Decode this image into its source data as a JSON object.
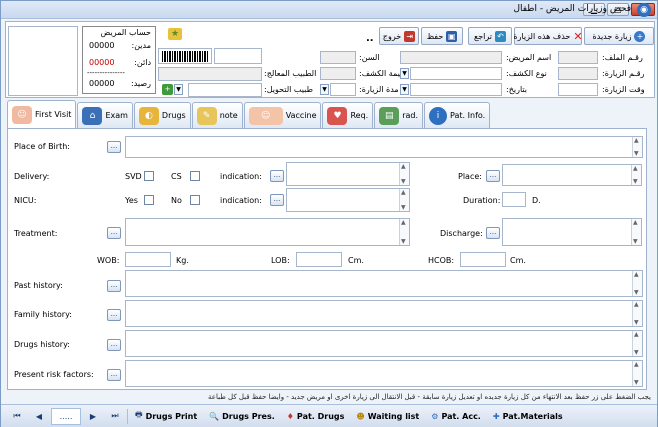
{
  "window": {
    "title": "فحص وزيارات المريض - اطفال"
  },
  "toolbar": {
    "new_visit": "زيارة جديدة",
    "delete_visit": "حذف هذه الزيارة",
    "undo": "تراجع",
    "save": "حفظ",
    "exit": "خروج",
    "dots": ".."
  },
  "header": {
    "file_no_label": "رقـم الملف:",
    "visit_no_label": "رقـم الزيارة:",
    "visit_time_label": "وقت الزيارة:",
    "patient_name_label": "اسم المريض:",
    "exam_type_label": "نوع الكشف:",
    "date_label": "بتاريخ:",
    "age_label": "السن:",
    "exam_value_label": "قيمة الكشف:",
    "visit_duration_label": "مدة الزيارة:",
    "treating_doctor_label": "الطبيب المعالج:",
    "referring_doctor_label": "طبيب التحويل:"
  },
  "account": {
    "title": "حساب المريض",
    "debit_label": "مدين:",
    "debit_value": "00000",
    "credit_label": "دائن:",
    "credit_value": "00000",
    "divider": "---------------",
    "balance_label": "رصيد:",
    "balance_value": "00000"
  },
  "tabs": [
    {
      "label": "First Visit",
      "icon": "baby-icon",
      "color": "#f2b9a1"
    },
    {
      "label": "Exam",
      "icon": "exam-icon",
      "color": "#3b6fb6"
    },
    {
      "label": "Drugs",
      "icon": "pills-icon",
      "color": "#e7b53a"
    },
    {
      "label": "note",
      "icon": "note-icon",
      "color": "#e8c55a"
    },
    {
      "label": "Vaccine",
      "icon": "vaccine-baby-icon",
      "color": "#f3c4a8"
    },
    {
      "label": "Req.",
      "icon": "request-icon",
      "color": "#d9534f"
    },
    {
      "label": "rad.",
      "icon": "radiology-icon",
      "color": "#5a9e5a"
    },
    {
      "label": "Pat. Info.",
      "icon": "info-icon",
      "color": "#2e6fbf"
    }
  ],
  "form": {
    "place_of_birth": "Place of Birth:",
    "delivery": "Delivery:",
    "svd": "SVD",
    "cs": "CS",
    "indication": "indication:",
    "place": "Place:",
    "nicu": "NICU:",
    "yes": "Yes",
    "no": "No",
    "indication2": "indication:",
    "duration": "Duration:",
    "duration_unit": "D.",
    "treatment": "Treatment:",
    "discharge": "Discharge:",
    "wob": "WOB:",
    "kg": "Kg.",
    "lob": "LOB:",
    "cm1": "Cm.",
    "hcob": "HCOB:",
    "cm2": "Cm.",
    "past_history": "Past history:",
    "family_history": "Family history:",
    "drugs_history": "Drugs history:",
    "present_risk": "Present risk factors:"
  },
  "footnote": "يجب الضغط على زر حفظ بعد الانتهاء من كل زيارة جديده او تعديل زيارة سابقة - قبل الانتقال الى زيارة اخرى او مريض جديد - وايضا حفظ قبل كل طباعة",
  "bottombar": {
    "pager": ".....",
    "drugs_print": "Drugs Print",
    "drugs_pres": "Drugs Pres.",
    "pat_drugs": "Pat. Drugs",
    "waiting_list": "Waiting list",
    "pat_acc": "Pat. Acc.",
    "pat_materials": "Pat.Materials"
  }
}
